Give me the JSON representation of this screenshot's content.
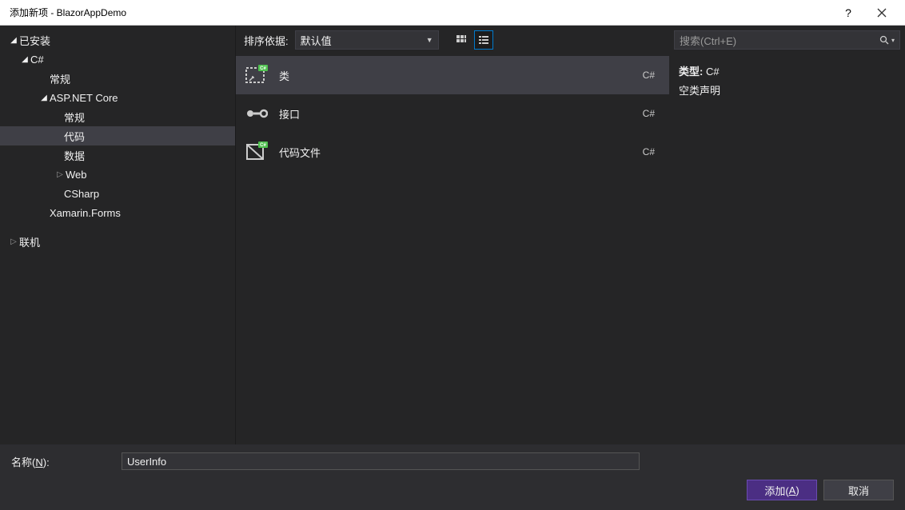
{
  "window": {
    "title": "添加新项 - BlazorAppDemo"
  },
  "sidebar": {
    "installed_label": "已安装",
    "online_label": "联机",
    "items": {
      "csharp": "C#",
      "general1": "常规",
      "aspnetcore": "ASP.NET Core",
      "general2": "常规",
      "code": "代码",
      "data": "数据",
      "web": "Web",
      "csharp2": "CSharp",
      "xamarin": "Xamarin.Forms"
    }
  },
  "toolbar": {
    "sort_label": "排序依据:",
    "sort_value": "默认值"
  },
  "templates": [
    {
      "name": "类",
      "lang": "C#",
      "icon": "class"
    },
    {
      "name": "接口",
      "lang": "C#",
      "icon": "interface"
    },
    {
      "name": "代码文件",
      "lang": "C#",
      "icon": "codefile"
    }
  ],
  "search": {
    "placeholder": "搜索(Ctrl+E)"
  },
  "details": {
    "type_label": "类型:",
    "type_value": "C#",
    "description": "空类声明"
  },
  "bottom": {
    "name_label_prefix": "名称(",
    "name_label_key": "N",
    "name_label_suffix": "):",
    "name_value": "UserInfo",
    "add_prefix": "添加(",
    "add_key": "A",
    "add_suffix": ")",
    "cancel_label": "取消"
  }
}
